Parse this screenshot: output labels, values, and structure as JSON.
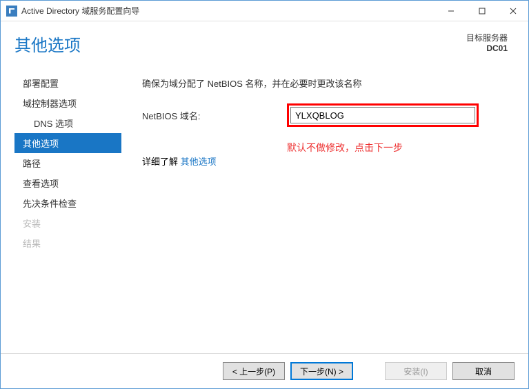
{
  "window": {
    "title": "Active Directory 域服务配置向导"
  },
  "header": {
    "page_title": "其他选项",
    "target_server_label": "目标服务器",
    "target_server_value": "DC01"
  },
  "sidebar": {
    "items": [
      {
        "label": "部署配置",
        "state": "enabled"
      },
      {
        "label": "域控制器选项",
        "state": "enabled"
      },
      {
        "label": "DNS 选项",
        "state": "enabled",
        "indent": true
      },
      {
        "label": "其他选项",
        "state": "active"
      },
      {
        "label": "路径",
        "state": "enabled"
      },
      {
        "label": "查看选项",
        "state": "enabled"
      },
      {
        "label": "先决条件检查",
        "state": "enabled"
      },
      {
        "label": "安装",
        "state": "disabled"
      },
      {
        "label": "结果",
        "state": "disabled"
      }
    ]
  },
  "content": {
    "instruction": "确保为域分配了 NetBIOS 名称，并在必要时更改该名称",
    "field_label": "NetBIOS 域名:",
    "field_value": "YLXQBLOG",
    "annotation": "默认不做修改，点击下一步",
    "learn_more_prefix": "详细了解 ",
    "learn_more_link": "其他选项"
  },
  "footer": {
    "prev": "< 上一步(P)",
    "next": "下一步(N) >",
    "install": "安装(I)",
    "cancel": "取消"
  }
}
